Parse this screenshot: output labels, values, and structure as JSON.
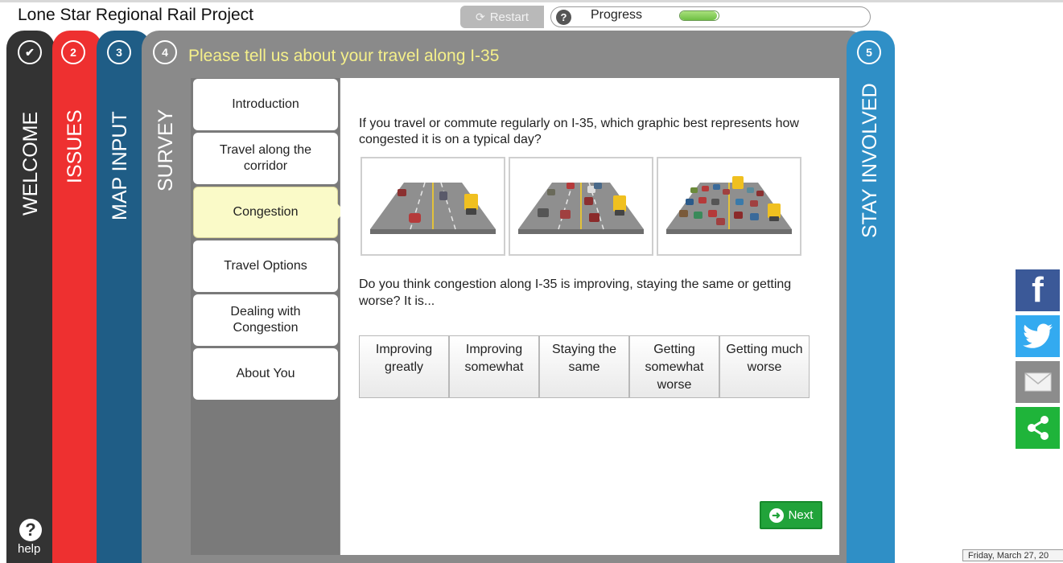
{
  "header": {
    "title": "Lone Star Regional Rail Project",
    "restart_label": "Restart",
    "progress_label": "Progress",
    "progress_fraction": 0.12
  },
  "tabs": [
    {
      "number": "✔",
      "label": "WELCOME",
      "color": "#333333"
    },
    {
      "number": "2",
      "label": "ISSUES",
      "color": "#ee3030"
    },
    {
      "number": "3",
      "label": "MAP INPUT",
      "color": "#1f5d86"
    },
    {
      "number": "4",
      "label": "SURVEY",
      "color": "#8a8a8a"
    },
    {
      "number": "5",
      "label": "STAY INVOLVED",
      "color": "#2f8fc6"
    }
  ],
  "survey": {
    "title": "Please tell us about your travel along I-35",
    "nav": [
      {
        "label": "Introduction",
        "active": false
      },
      {
        "label": "Travel along the corridor",
        "active": false
      },
      {
        "label": "Congestion",
        "active": true
      },
      {
        "label": "Travel Options",
        "active": false
      },
      {
        "label": "Dealing with Congestion",
        "active": false
      },
      {
        "label": "About You",
        "active": false
      }
    ],
    "question1": "If you travel or commute regularly on I-35, which graphic best represents how congested it is on a typical day?",
    "graphics": [
      {
        "name": "light-traffic-graphic",
        "vehicles": "light"
      },
      {
        "name": "moderate-traffic-graphic",
        "vehicles": "moderate"
      },
      {
        "name": "heavy-traffic-graphic",
        "vehicles": "heavy"
      }
    ],
    "question2": "Do you think congestion along I-35 is improving, staying the same or getting worse? It is...",
    "options": [
      {
        "label": "Improving greatly"
      },
      {
        "label": "Improving somewhat"
      },
      {
        "label": "Staying the same"
      },
      {
        "label": "Getting somewhat worse"
      },
      {
        "label": "Getting much worse"
      }
    ],
    "next_label": "Next"
  },
  "help": {
    "label": "help"
  },
  "social": [
    {
      "name": "facebook-icon",
      "color": "#3b5998"
    },
    {
      "name": "twitter-icon",
      "color": "#33aaf0"
    },
    {
      "name": "email-icon",
      "color": "#8c8c8c"
    },
    {
      "name": "share-icon",
      "color": "#1fb43a"
    }
  ],
  "footer": {
    "date": "Friday, March 27, 20"
  }
}
